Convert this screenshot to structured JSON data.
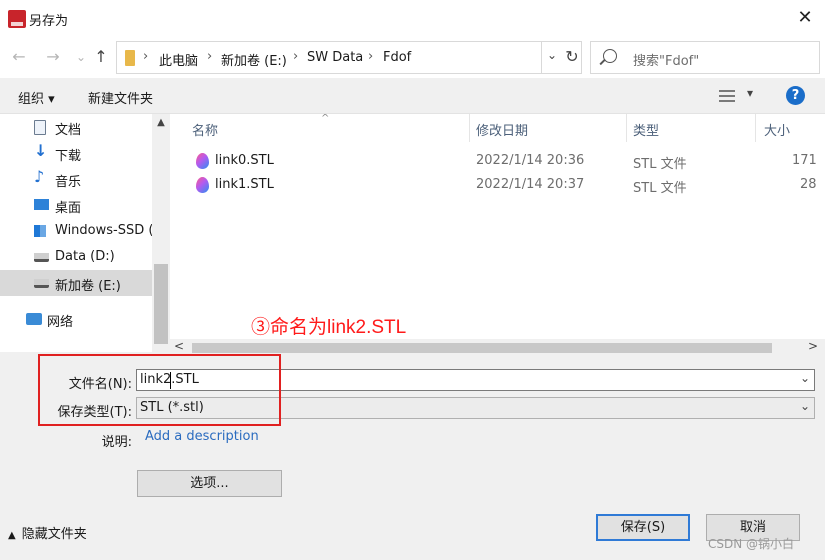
{
  "window": {
    "title": "另存为",
    "close_glyph": "✕"
  },
  "nav": {
    "back": "←",
    "forward": "→",
    "recent": "⌄",
    "up": "↑",
    "breadcrumbs": [
      "此电脑",
      "新加卷 (E:)",
      "SW Data",
      "Fdof"
    ],
    "separator": "›",
    "dropdown": "⌄",
    "refresh": "↻",
    "search_placeholder": "搜索\"Fdof\""
  },
  "toolbar": {
    "organize": "组织 ▾",
    "new_folder": "新建文件夹",
    "view_dd": "▾",
    "help": "?"
  },
  "sidebar": {
    "items": [
      {
        "label": "文档",
        "icon": "document-icon"
      },
      {
        "label": "下载",
        "icon": "download-icon"
      },
      {
        "label": "音乐",
        "icon": "music-icon"
      },
      {
        "label": "桌面",
        "icon": "desktop-icon"
      },
      {
        "label": "Windows-SSD (",
        "icon": "windows-drive-icon"
      },
      {
        "label": "Data (D:)",
        "icon": "drive-icon"
      },
      {
        "label": "新加卷 (E:)",
        "icon": "drive-icon",
        "selected": true
      },
      {
        "label": "网络",
        "icon": "network-icon"
      }
    ],
    "scroll_up": "▲"
  },
  "filelist": {
    "columns": [
      "名称",
      "修改日期",
      "类型",
      "大小"
    ],
    "sort_indicator": "^",
    "rows": [
      {
        "name": "link0.STL",
        "date": "2022/1/14 20:36",
        "type": "STL 文件",
        "size": "171"
      },
      {
        "name": "link1.STL",
        "date": "2022/1/14 20:37",
        "type": "STL 文件",
        "size": "28"
      }
    ],
    "scroll_left": "<",
    "scroll_right": ">"
  },
  "annotation": "③命名为link2.STL",
  "form": {
    "filename_label": "文件名(N):",
    "filename_value": "link2.STL",
    "filetype_label": "保存类型(T):",
    "filetype_value": "STL (*.stl)",
    "description_label": "说明:",
    "description_link": "Add a description",
    "dropdown_glyph": "⌄",
    "options_button": "选项...",
    "save_button": "保存(S)",
    "cancel_button": "取消",
    "hide_folders": "隐藏文件夹",
    "hide_folders_glyph": "▲"
  },
  "watermark": "CSDN @锅小白",
  "colors": {
    "accent": "#2f7ad6",
    "annotation": "#ff1a1a",
    "highlight": "#e02020"
  }
}
